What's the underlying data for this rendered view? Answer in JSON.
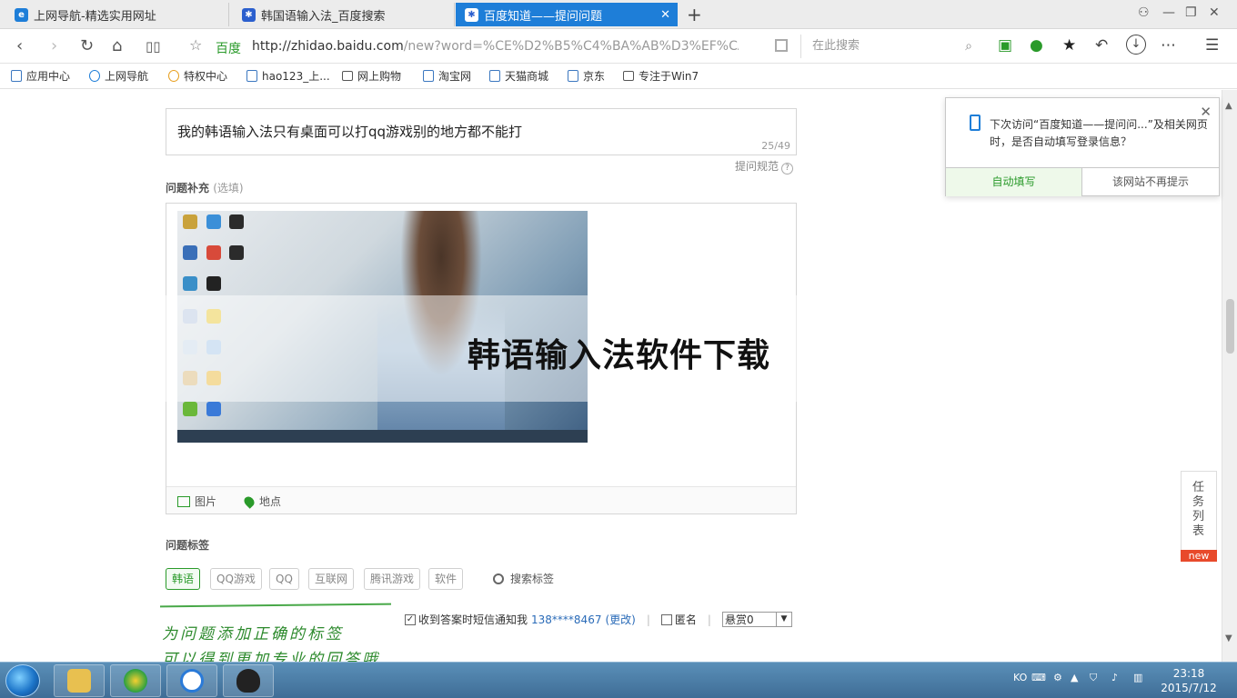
{
  "tabs": [
    {
      "label": "上网导航-精选实用网址"
    },
    {
      "label": "韩国语输入法_百度搜索"
    },
    {
      "label": "百度知道——提问问题"
    }
  ],
  "address": {
    "site_name": "百度",
    "url_main": "http://zhidao.baidu.com",
    "url_rest": "/new?word=%CE%D2%B5%C4%BA%AB%D3%EF%CA%E",
    "search_placeholder": "在此搜索"
  },
  "bookmarks": [
    {
      "label": "应用中心"
    },
    {
      "label": "上网导航"
    },
    {
      "label": "特权中心"
    },
    {
      "label": "hao123_上..."
    },
    {
      "label": "网上购物"
    },
    {
      "label": "淘宝网"
    },
    {
      "label": "天猫商城"
    },
    {
      "label": "京东"
    },
    {
      "label": "专注于Win7"
    }
  ],
  "question": {
    "title": "我的韩语输入法只有桌面可以打qq游戏别的地方都不能打",
    "count": "25/49",
    "rules": "提问规范",
    "supplement_label": "问题补充",
    "supplement_optional": "(选填)",
    "tool_image": "图片",
    "tool_location": "地点"
  },
  "overlay_title": "韩语输入法软件下载",
  "tags": {
    "label": "问题标签",
    "items": [
      "韩语",
      "QQ游戏",
      "QQ",
      "互联网",
      "腾讯游戏",
      "软件"
    ],
    "search": "搜索标签"
  },
  "handwriting": [
    "为问题添加正确的标签",
    "可以得到更加专业的回答哦"
  ],
  "notify": {
    "sms_text": "收到答案时短信通知我",
    "phone": "138****8467",
    "change": "(更改)",
    "anonymous": "匿名",
    "reward": "悬赏0"
  },
  "popup": {
    "message": "下次访问“百度知道——提问问...”及相关网页时，是否自动填写登录信息？",
    "button_fill": "自动填写",
    "button_never": "该网站不再提示"
  },
  "task_list": {
    "label": "任务列表",
    "badge": "new"
  },
  "clock": {
    "time": "23:18",
    "date": "2015/7/12"
  }
}
